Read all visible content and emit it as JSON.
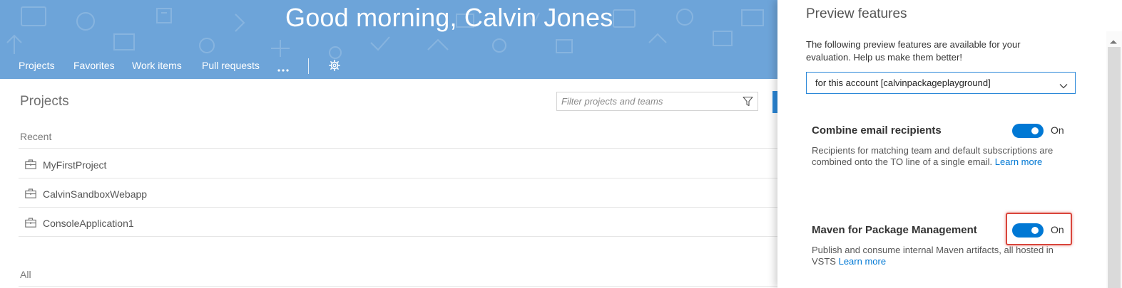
{
  "header": {
    "greeting": "Good morning, Calvin Jones",
    "nav": [
      {
        "label": "Projects"
      },
      {
        "label": "Favorites"
      },
      {
        "label": "Work items"
      },
      {
        "label": "Pull requests"
      }
    ],
    "more_icon": "ellipsis-icon",
    "settings_icon": "gear-icon"
  },
  "main": {
    "title": "Projects",
    "filter_placeholder": "Filter projects and teams",
    "recent_label": "Recent",
    "recent_projects": [
      {
        "name": "MyFirstProject"
      },
      {
        "name": "CalvinSandboxWebapp"
      },
      {
        "name": "ConsoleApplication1"
      }
    ],
    "all_label": "All"
  },
  "panel": {
    "title": "Preview features",
    "description": "The following preview features are available for your evaluation. Help us make them better!",
    "scope": "for this account [calvinpackageplayground]",
    "features": [
      {
        "name": "Combine email recipients",
        "state": "On",
        "enabled": true,
        "description": "Recipients for matching team and default subscriptions are combined onto the TO line of a single email.",
        "link": "Learn more"
      },
      {
        "name": "Maven for Package Management",
        "state": "On",
        "enabled": true,
        "description": "Publish and consume internal Maven artifacts, all hosted in VSTS",
        "link": "Learn more"
      }
    ]
  },
  "colors": {
    "banner": "#6da4d9",
    "accent": "#0078d4",
    "highlight": "#d9453b"
  }
}
